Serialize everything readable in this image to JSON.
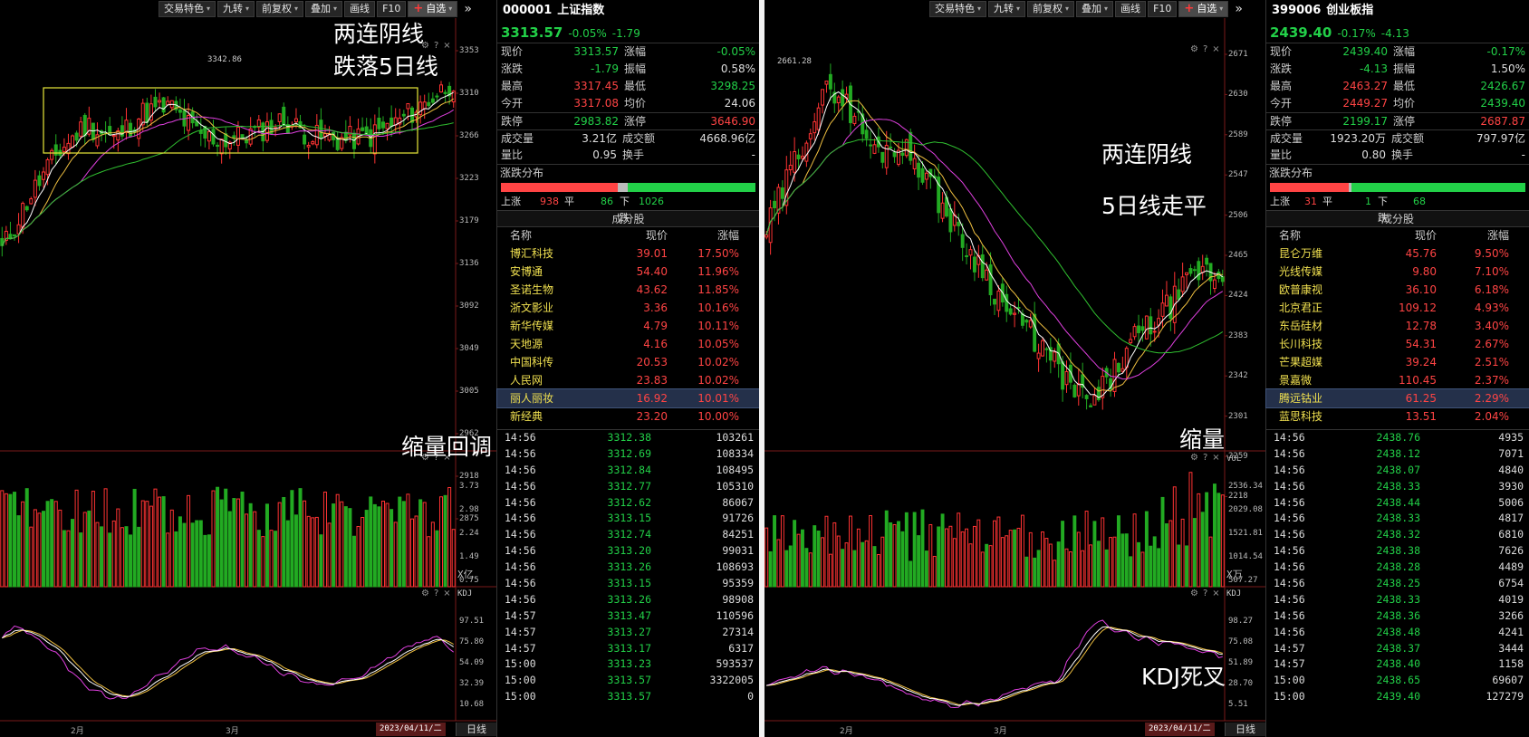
{
  "toolbar": {
    "buttons": [
      "交易特色",
      "九转",
      "前复权",
      "叠加",
      "画线",
      "F10"
    ],
    "watch": "自选"
  },
  "left": {
    "y_labels": [
      "3353",
      "3310",
      "3266",
      "3223",
      "3179",
      "3136",
      "3092",
      "3049",
      "3005",
      "2962",
      "2918",
      "2875"
    ],
    "high_label": "3342.86",
    "vol_labels": [
      "3.73",
      "2.98",
      "2.24",
      "1.49",
      "0.75"
    ],
    "vol_unit": "X亿",
    "kdj_label": "KDJ",
    "kdj_labels": [
      "97.51",
      "75.80",
      "54.09",
      "32.39",
      "10.68"
    ],
    "x_labels": [
      "2月",
      "3月"
    ],
    "date": "2023/04/11/二",
    "period": "日线",
    "annotations": {
      "a1": "两连阴线",
      "a2": "跌落5日线",
      "a3": "缩量回调"
    },
    "stock": {
      "code": "000001",
      "name": "上证指数",
      "price": "3313.57",
      "pct": "-0.05%",
      "chg": "-1.79"
    },
    "quote": [
      {
        "k": "现价",
        "v": "3313.57",
        "vc": "grn",
        "k2": "涨幅",
        "v2": "-0.05%",
        "v2c": "grn"
      },
      {
        "k": "涨跌",
        "v": "-1.79",
        "vc": "grn",
        "k2": "振幅",
        "v2": "0.58%",
        "v2c": "wht"
      },
      {
        "k": "最高",
        "v": "3317.45",
        "vc": "red",
        "k2": "最低",
        "v2": "3298.25",
        "v2c": "grn"
      },
      {
        "k": "今开",
        "v": "3317.08",
        "vc": "red",
        "k2": "均价",
        "v2": "24.06",
        "v2c": "wht"
      }
    ],
    "limit": {
      "k": "跌停",
      "v": "2983.82",
      "k2": "涨停",
      "v2": "3646.90"
    },
    "vol": [
      {
        "k": "成交量",
        "v": "3.21亿",
        "k2": "成交额",
        "v2": "4668.96亿"
      },
      {
        "k": "量比",
        "v": "0.95",
        "k2": "换手",
        "v2": "-"
      }
    ],
    "dist": {
      "title": "涨跌分布",
      "up_label": "上涨",
      "up": "938",
      "flat_label": "平",
      "flat": "86",
      "down_label": "下跌",
      "down": "1026"
    },
    "comp": {
      "title": "成分股",
      "h1": "名称",
      "h2": "现价",
      "h3": "涨幅",
      "rows": [
        {
          "n": "博汇科技",
          "p": "39.01",
          "g": "17.50%"
        },
        {
          "n": "安博通",
          "p": "54.40",
          "g": "11.96%"
        },
        {
          "n": "圣诺生物",
          "p": "43.62",
          "g": "11.85%"
        },
        {
          "n": "浙文影业",
          "p": "3.36",
          "g": "10.16%"
        },
        {
          "n": "新华传媒",
          "p": "4.79",
          "g": "10.11%"
        },
        {
          "n": "天地源",
          "p": "4.16",
          "g": "10.05%"
        },
        {
          "n": "中国科传",
          "p": "20.53",
          "g": "10.02%"
        },
        {
          "n": "人民网",
          "p": "23.83",
          "g": "10.02%"
        },
        {
          "n": "丽人丽妆",
          "p": "16.92",
          "g": "10.01%"
        },
        {
          "n": "新经典",
          "p": "23.20",
          "g": "10.00%"
        }
      ]
    },
    "ticks": [
      {
        "t": "14:56",
        "p": "3312.38",
        "v": "103261"
      },
      {
        "t": "14:56",
        "p": "3312.69",
        "v": "108334"
      },
      {
        "t": "14:56",
        "p": "3312.84",
        "v": "108495"
      },
      {
        "t": "14:56",
        "p": "3312.77",
        "v": "105310"
      },
      {
        "t": "14:56",
        "p": "3312.62",
        "v": "86067"
      },
      {
        "t": "14:56",
        "p": "3313.15",
        "v": "91726"
      },
      {
        "t": "14:56",
        "p": "3312.74",
        "v": "84251"
      },
      {
        "t": "14:56",
        "p": "3313.20",
        "v": "99031"
      },
      {
        "t": "14:56",
        "p": "3313.26",
        "v": "108693"
      },
      {
        "t": "14:56",
        "p": "3313.15",
        "v": "95359"
      },
      {
        "t": "14:56",
        "p": "3313.26",
        "v": "98908"
      },
      {
        "t": "14:57",
        "p": "3313.47",
        "v": "110596"
      },
      {
        "t": "14:57",
        "p": "3313.27",
        "v": "27314"
      },
      {
        "t": "14:57",
        "p": "3313.17",
        "v": "6317"
      },
      {
        "t": "15:00",
        "p": "3313.23",
        "v": "593537"
      },
      {
        "t": "15:00",
        "p": "3313.57",
        "v": "3322005"
      },
      {
        "t": "15:00",
        "p": "3313.57",
        "v": "0"
      }
    ]
  },
  "right": {
    "y_labels": [
      "2671",
      "2630",
      "2589",
      "2547",
      "2506",
      "2465",
      "2424",
      "2383",
      "2342",
      "2301",
      "2259",
      "2218"
    ],
    "high_label": "2661.28",
    "vol_label": "VOL",
    "vol_labels": [
      "2536.34",
      "2029.08",
      "1521.81",
      "1014.54",
      "507.27"
    ],
    "vol_unit": "X万",
    "kdj_label": "KDJ",
    "kdj_labels": [
      "98.27",
      "75.08",
      "51.89",
      "28.70",
      "5.51"
    ],
    "x_labels": [
      "2月",
      "3月"
    ],
    "date": "2023/04/11/二",
    "period": "日线",
    "annotations": {
      "a1": "两连阴线",
      "a2": "5日线走平",
      "a3": "缩量",
      "a4": "KDJ死叉"
    },
    "stock": {
      "code": "399006",
      "name": "创业板指",
      "price": "2439.40",
      "pct": "-0.17%",
      "chg": "-4.13"
    },
    "quote": [
      {
        "k": "现价",
        "v": "2439.40",
        "vc": "grn",
        "k2": "涨幅",
        "v2": "-0.17%",
        "v2c": "grn"
      },
      {
        "k": "涨跌",
        "v": "-4.13",
        "vc": "grn",
        "k2": "振幅",
        "v2": "1.50%",
        "v2c": "wht"
      },
      {
        "k": "最高",
        "v": "2463.27",
        "vc": "red",
        "k2": "最低",
        "v2": "2426.67",
        "v2c": "grn"
      },
      {
        "k": "今开",
        "v": "2449.27",
        "vc": "red",
        "k2": "均价",
        "v2": "2439.40",
        "v2c": "grn"
      }
    ],
    "limit": {
      "k": "跌停",
      "v": "2199.17",
      "k2": "涨停",
      "v2": "2687.87"
    },
    "vol": [
      {
        "k": "成交量",
        "v": "1923.20万",
        "k2": "成交额",
        "v2": "797.97亿"
      },
      {
        "k": "量比",
        "v": "0.80",
        "k2": "换手",
        "v2": "-"
      }
    ],
    "dist": {
      "title": "涨跌分布",
      "up_label": "上涨",
      "up": "31",
      "flat_label": "平",
      "flat": "1",
      "down_label": "下跌",
      "down": "68"
    },
    "comp": {
      "title": "成分股",
      "h1": "名称",
      "h2": "现价",
      "h3": "涨幅",
      "rows": [
        {
          "n": "昆仑万维",
          "p": "45.76",
          "g": "9.50%"
        },
        {
          "n": "光线传媒",
          "p": "9.80",
          "g": "7.10%"
        },
        {
          "n": "欧普康视",
          "p": "36.10",
          "g": "6.18%"
        },
        {
          "n": "北京君正",
          "p": "109.12",
          "g": "4.93%"
        },
        {
          "n": "东岳硅材",
          "p": "12.78",
          "g": "3.40%"
        },
        {
          "n": "长川科技",
          "p": "54.31",
          "g": "2.67%"
        },
        {
          "n": "芒果超媒",
          "p": "39.24",
          "g": "2.51%"
        },
        {
          "n": "景嘉微",
          "p": "110.45",
          "g": "2.37%"
        },
        {
          "n": "腾远钴业",
          "p": "61.25",
          "g": "2.29%"
        },
        {
          "n": "蓝思科技",
          "p": "13.51",
          "g": "2.04%"
        }
      ]
    },
    "ticks": [
      {
        "t": "14:56",
        "p": "2438.76",
        "v": "4935"
      },
      {
        "t": "14:56",
        "p": "2438.12",
        "v": "7071"
      },
      {
        "t": "14:56",
        "p": "2438.07",
        "v": "4840"
      },
      {
        "t": "14:56",
        "p": "2438.33",
        "v": "3930"
      },
      {
        "t": "14:56",
        "p": "2438.44",
        "v": "5006"
      },
      {
        "t": "14:56",
        "p": "2438.33",
        "v": "4817"
      },
      {
        "t": "14:56",
        "p": "2438.32",
        "v": "6810"
      },
      {
        "t": "14:56",
        "p": "2438.38",
        "v": "7626"
      },
      {
        "t": "14:56",
        "p": "2438.28",
        "v": "4489"
      },
      {
        "t": "14:56",
        "p": "2438.25",
        "v": "6754"
      },
      {
        "t": "14:56",
        "p": "2438.33",
        "v": "4019"
      },
      {
        "t": "14:56",
        "p": "2438.36",
        "v": "3266"
      },
      {
        "t": "14:56",
        "p": "2438.48",
        "v": "4241"
      },
      {
        "t": "14:57",
        "p": "2438.37",
        "v": "3444"
      },
      {
        "t": "14:57",
        "p": "2438.40",
        "v": "1158"
      },
      {
        "t": "15:00",
        "p": "2438.65",
        "v": "69607"
      },
      {
        "t": "15:00",
        "p": "2439.40",
        "v": "127279"
      }
    ]
  },
  "colors": {
    "up": "#ff3333",
    "down": "#22aa22",
    "ma5": "#ffffff",
    "ma10": "#f0c040",
    "ma20": "#e040e0",
    "ma60": "#30c030",
    "bg": "#000000",
    "box": "#e8e83a"
  }
}
